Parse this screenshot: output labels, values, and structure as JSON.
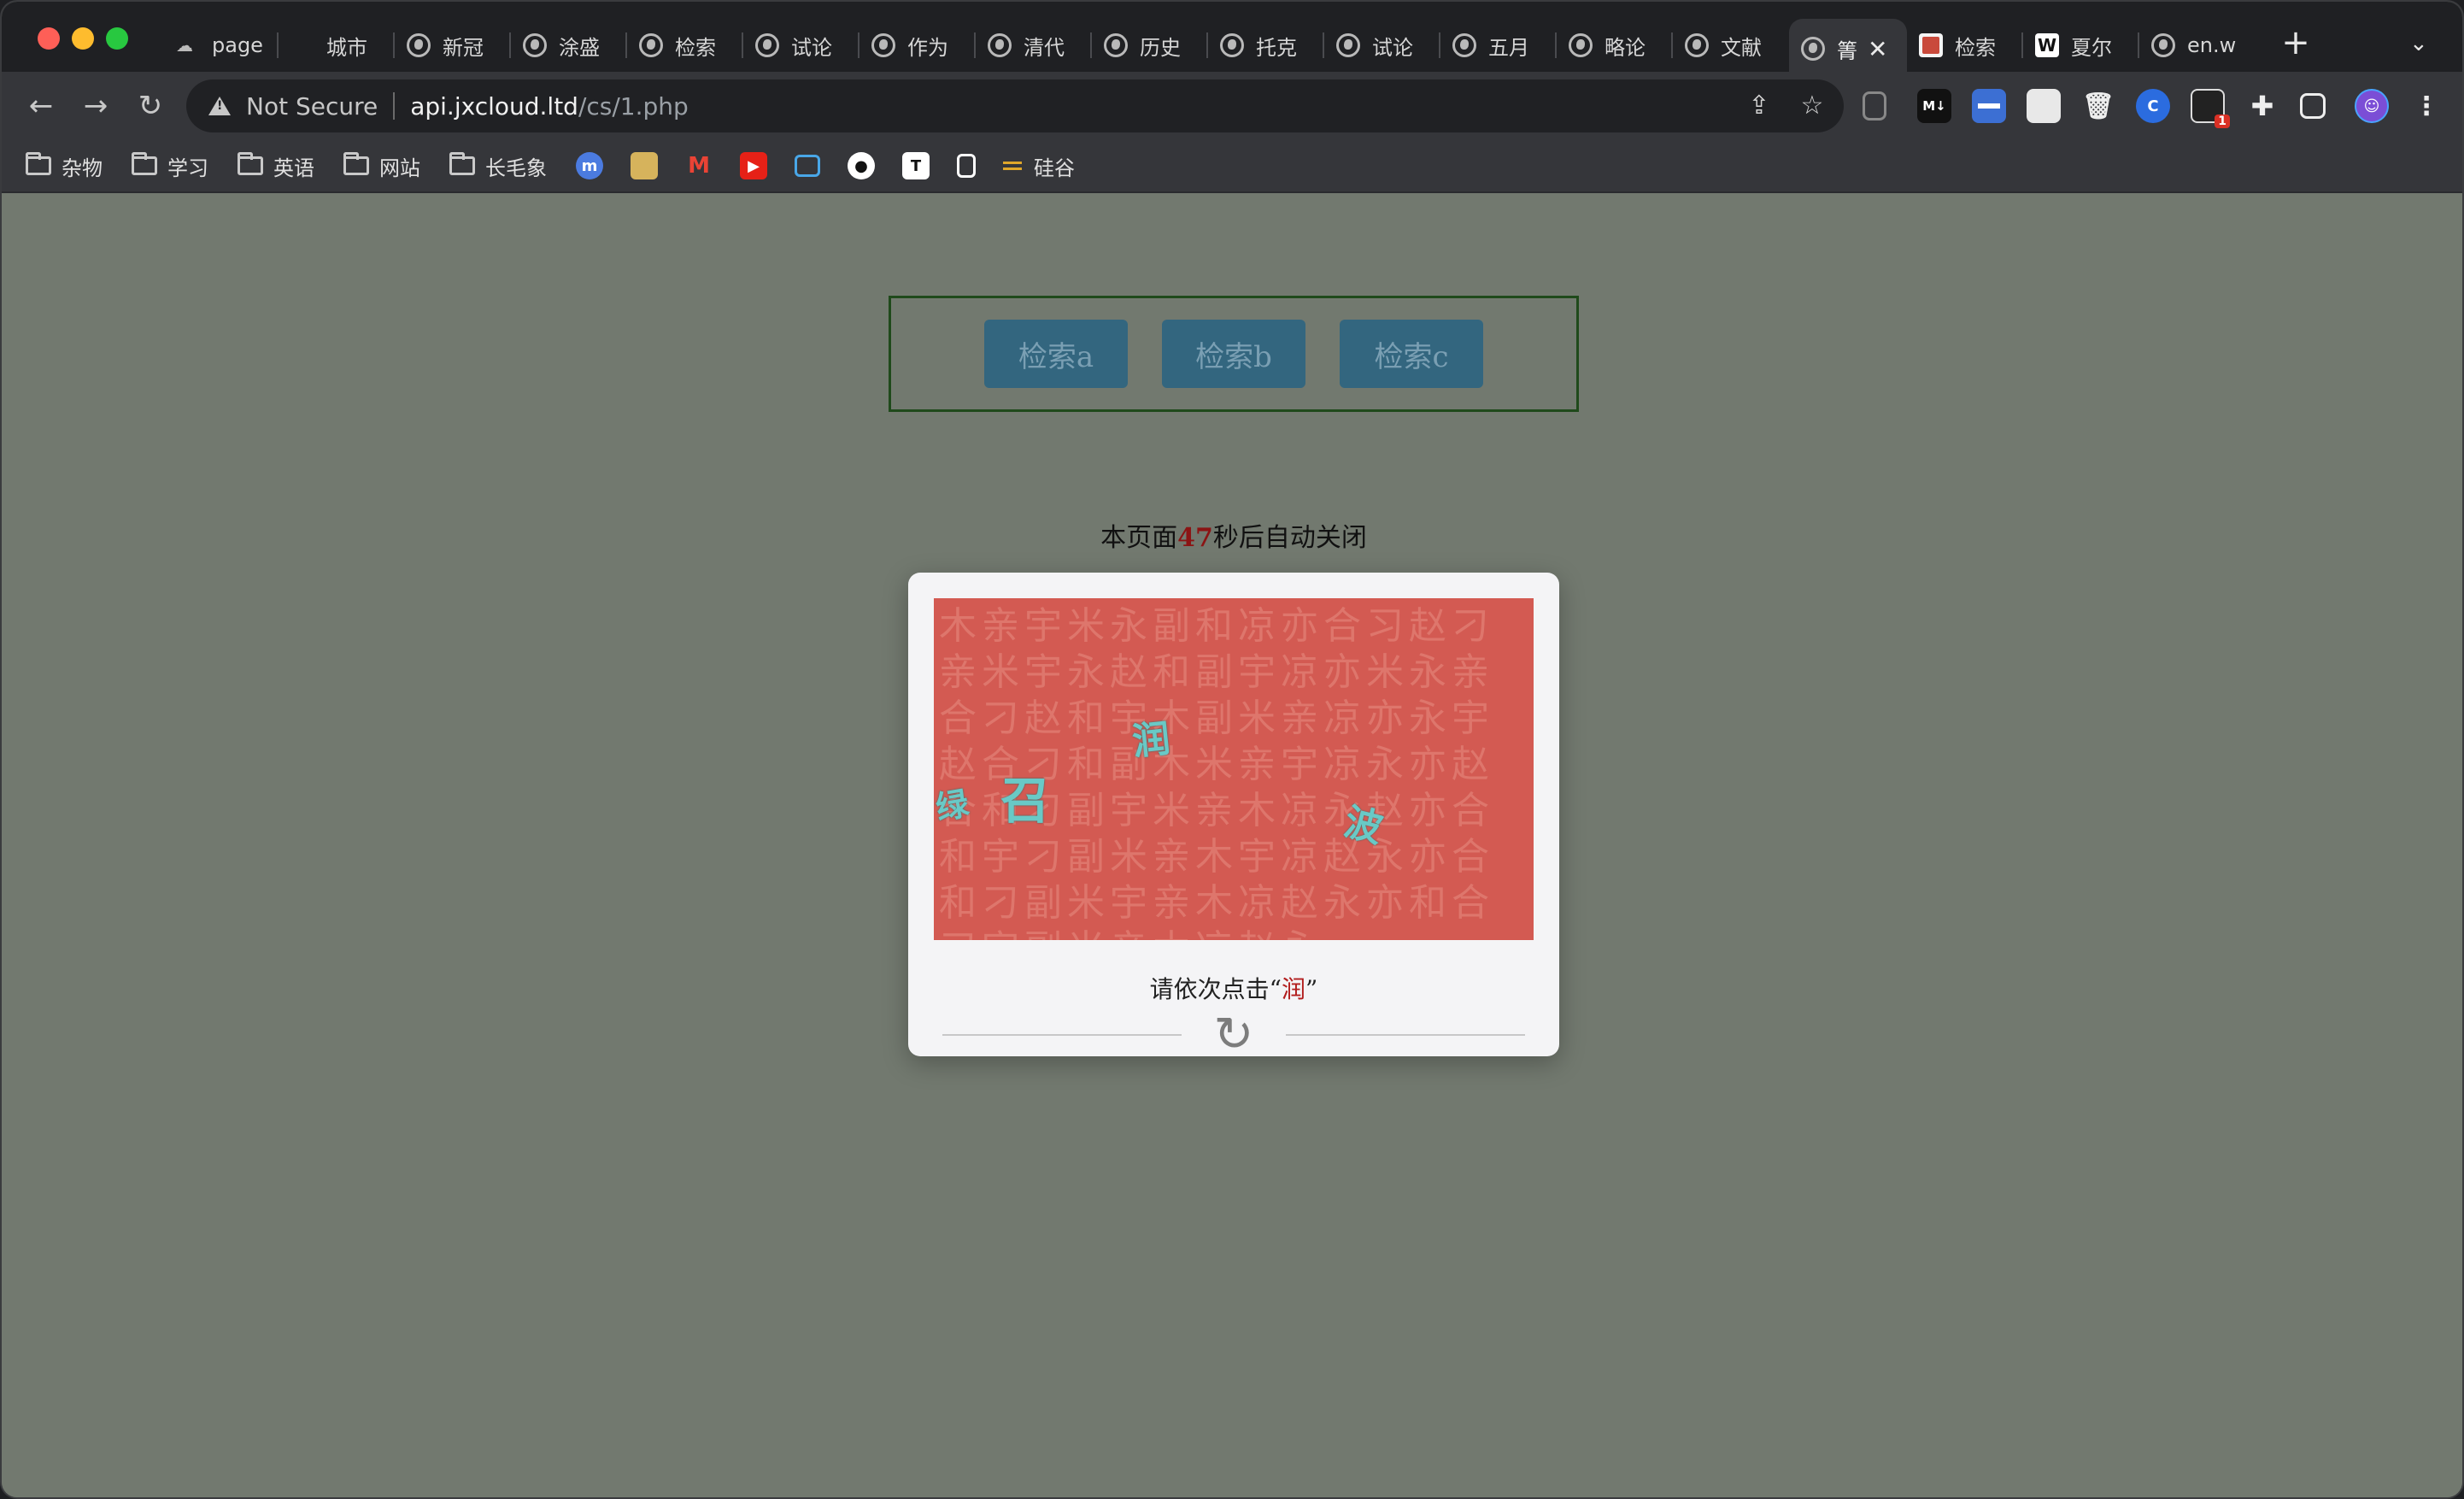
{
  "browser": {
    "tabs": [
      {
        "label": "page",
        "favicon": "cloud-icon"
      },
      {
        "label": "城市",
        "favicon": "blank-icon"
      },
      {
        "label": "新冠",
        "favicon": "globe-icon"
      },
      {
        "label": "涂盛",
        "favicon": "globe-icon"
      },
      {
        "label": "检索",
        "favicon": "globe-icon"
      },
      {
        "label": "试论",
        "favicon": "globe-icon"
      },
      {
        "label": "作为",
        "favicon": "globe-icon"
      },
      {
        "label": "清代",
        "favicon": "globe-icon"
      },
      {
        "label": "历史",
        "favicon": "globe-icon"
      },
      {
        "label": "托克",
        "favicon": "globe-icon"
      },
      {
        "label": "试论",
        "favicon": "globe-icon"
      },
      {
        "label": "五月",
        "favicon": "globe-icon"
      },
      {
        "label": "略论",
        "favicon": "globe-icon"
      },
      {
        "label": "文献",
        "favicon": "globe-icon"
      },
      {
        "label": "箐",
        "favicon": "globe-icon",
        "active": true
      },
      {
        "label": "检索",
        "favicon": "red-square-icon"
      },
      {
        "label": "夏尔",
        "favicon": "wikipedia-icon"
      },
      {
        "label": "en.w",
        "favicon": "globe-icon"
      }
    ],
    "tab_close_glyph": "✕",
    "new_tab_glyph": "+",
    "tab_menu_glyph": "⌄",
    "security_text": "Not Secure",
    "url_host": "api.jxcloud.ltd",
    "url_path": "/cs/1.php",
    "extension_badge": "1",
    "bookmarks": [
      {
        "label": "杂物",
        "type": "folder"
      },
      {
        "label": "学习",
        "type": "folder"
      },
      {
        "label": "英语",
        "type": "folder"
      },
      {
        "label": "网站",
        "type": "folder"
      },
      {
        "label": "长毛象",
        "type": "folder"
      },
      {
        "label": "硅谷",
        "type": "link"
      }
    ]
  },
  "page": {
    "search_buttons": [
      "检索a",
      "检索b",
      "检索c"
    ],
    "countdown": {
      "prefix": "本页面",
      "seconds": "47",
      "suffix": "秒后自动关闭"
    },
    "captcha": {
      "chars": [
        "润",
        "召",
        "绿",
        "波"
      ],
      "prompt_prefix": "请依次点击“",
      "prompt_target": "润",
      "prompt_suffix": "”",
      "refresh_glyph": "↻"
    }
  },
  "colors": {
    "page_bg": "#72796f",
    "button_bg": "#33667f",
    "captcha_bg": "#d35a52",
    "captcha_char": "#69c9c6",
    "highlight": "#b21d1d"
  }
}
